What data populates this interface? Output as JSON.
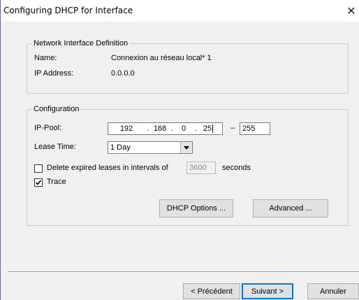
{
  "window": {
    "title": "Configuring DHCP for Interface",
    "close_label": "✕"
  },
  "network_interface_definition": {
    "legend": "Network Interface Definition",
    "name_label": "Name:",
    "name_value": "Connexion au réseau local* 1",
    "ip_label": "IP Address:",
    "ip_value": "0.0.0.0"
  },
  "configuration": {
    "legend": "Configuration",
    "ip_pool_label": "IP-Pool:",
    "ip_pool_start": [
      "192",
      "168",
      "0",
      "25"
    ],
    "range_dash": "–",
    "ip_pool_end": "255",
    "lease_time_label": "Lease Time:",
    "lease_time_value": "1 Day",
    "delete_expired_label": "Delete expired leases in intervals of",
    "delete_expired_checked": false,
    "interval_value": "3600",
    "interval_unit": "seconds",
    "trace_label": "Trace",
    "trace_checked": true,
    "dhcp_options_button": "DHCP Options ...",
    "advanced_button": "Advanced ..."
  },
  "footer": {
    "back_button": "< Précédent",
    "next_button": "Suivant >",
    "cancel_button": "Annuler"
  }
}
